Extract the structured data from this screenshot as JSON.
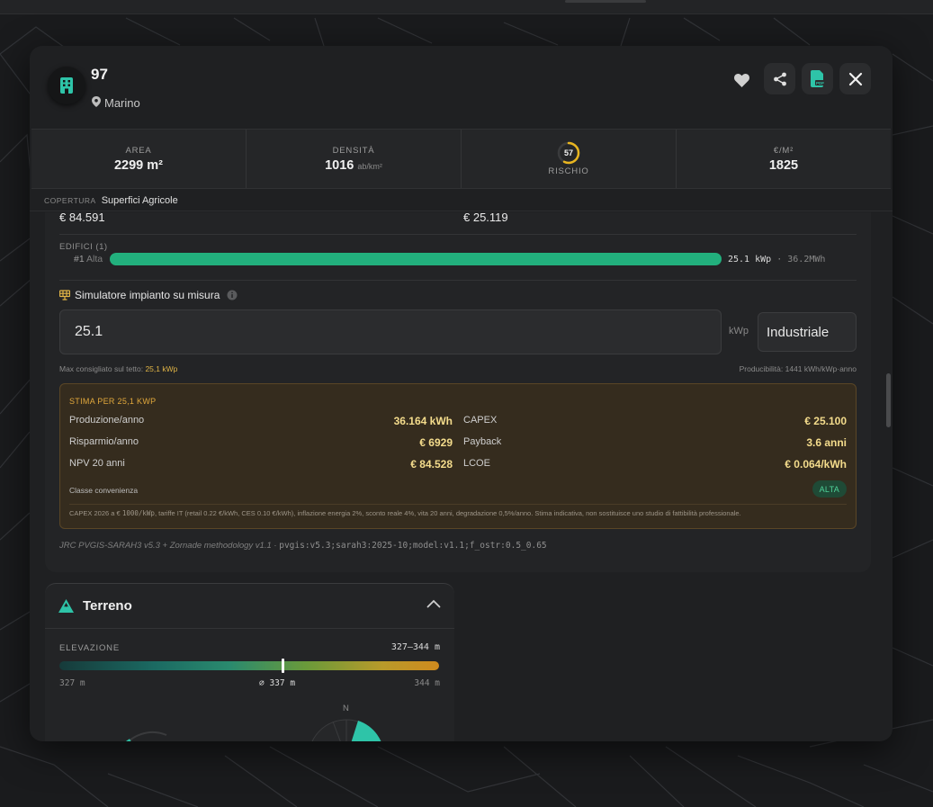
{
  "header": {
    "title": "97",
    "location": "Marino"
  },
  "stats": {
    "area": {
      "label": "AREA",
      "value": "2299 m²"
    },
    "density": {
      "label": "DENSITÀ",
      "value": "1016",
      "unit": "ab/km²"
    },
    "risk": {
      "label": "RISCHIO",
      "value": "57",
      "level": 0.57,
      "color": "#e8b520"
    },
    "price": {
      "label": "€/M²",
      "value": "1825"
    }
  },
  "copertura": {
    "label": "COPERTURA",
    "value": "Superfici Agricole"
  },
  "finance_row": {
    "left": "€ 84.591",
    "right": "€ 25.119"
  },
  "edifici": {
    "label": "EDIFICI (1)",
    "items": [
      {
        "index": "#1",
        "tag": "Alta",
        "power": "25.1 kWp",
        "sep": "·",
        "energy": "36.2MWh",
        "color": "#22b07d"
      }
    ]
  },
  "simulator": {
    "title": "Simulatore impianto su misura",
    "value": "25.1",
    "unit": "kWp",
    "type_selected": "Industriale",
    "hint_prefix": "Max consigliato sul tetto:",
    "hint_value": "25,1 kWp",
    "producibility": "Producibilità: 1441 kWh/kWp·anno"
  },
  "estimate": {
    "title": "STIMA PER 25,1 KWP",
    "left": [
      {
        "label": "Produzione/anno",
        "value": "36.164 kWh"
      },
      {
        "label": "Risparmio/anno",
        "value": "€ 6929"
      },
      {
        "label": "NPV 20 anni",
        "value": "€ 84.528"
      }
    ],
    "right": [
      {
        "label": "CAPEX",
        "value": "€ 25.100"
      },
      {
        "label": "Payback",
        "value": "3.6 anni"
      },
      {
        "label": "LCOE",
        "value": "€ 0.064/kWh"
      }
    ],
    "class_label": "Classe convenienza",
    "class_value": "ALTA",
    "note_prefix": "CAPEX 2026 a €",
    "note_mono": "1000/kWp",
    "note_suffix": ", tariffe IT (retail 0.22 €/kWh, CES 0.10 €/kWh), inflazione energia 2%, sconto reale 4%, vita 20 anni, degradazione 0,5%/anno. Stima indicativa, non sostituisce uno studio di fattibilità professionale."
  },
  "source": {
    "text": "JRC PVGIS-SARAH3 v5.3 + Zornade methodology v1.1",
    "sep": "·",
    "code": "pvgis:v5.3;sarah3:2025-10;model:v1.1;f_ostr:0.5_0.65"
  },
  "terreno": {
    "title": "Terreno",
    "elev_label": "ELEVAZIONE",
    "elev_range": "327–344 m",
    "elev_min": "327 m",
    "elev_avg": "⌀ 337 m",
    "elev_max": "344 m",
    "elev_avg_fraction": 0.59,
    "compass_n": "N"
  },
  "colors": {
    "accent_teal": "#2ec4a8",
    "accent_gold": "#e1b546",
    "bar_green": "#22b07d"
  }
}
